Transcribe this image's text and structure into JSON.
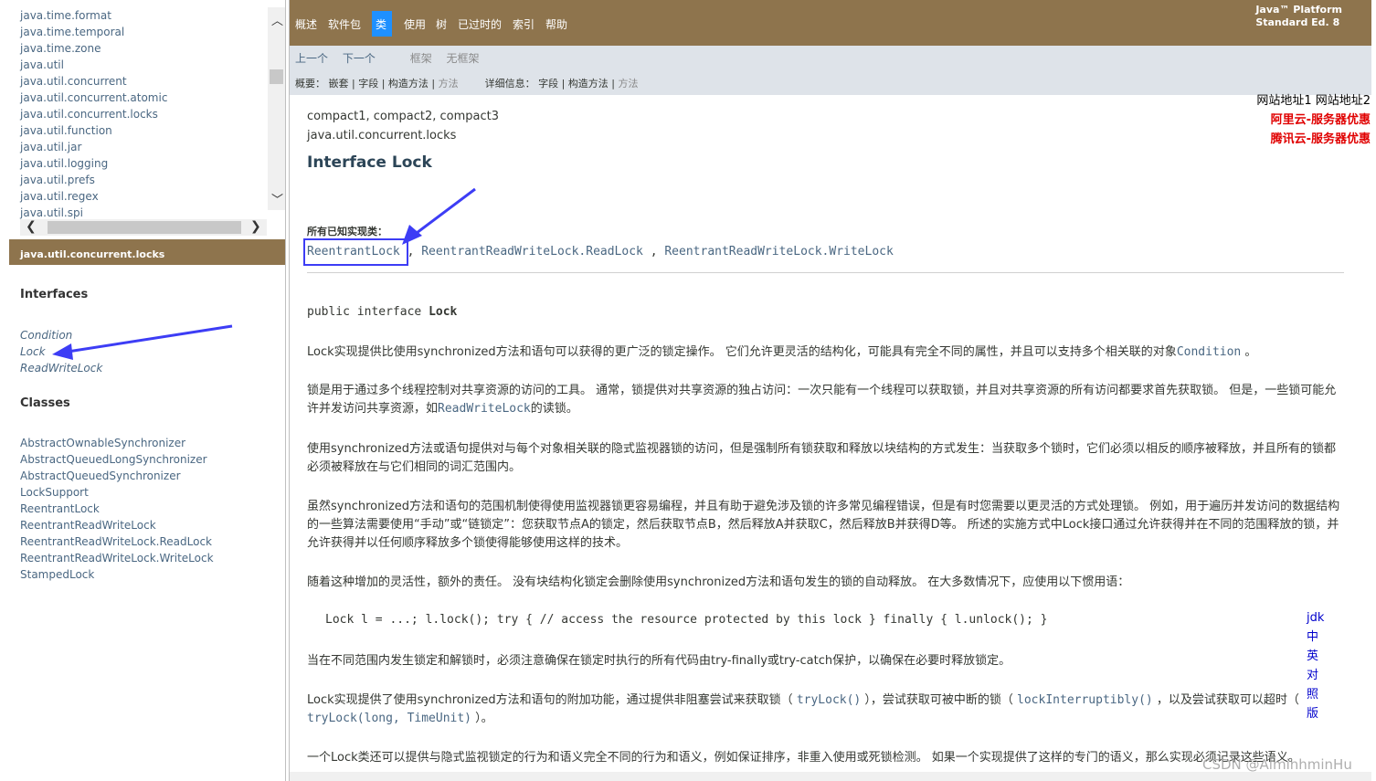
{
  "package_list": [
    "java.time.format",
    "java.time.temporal",
    "java.time.zone",
    "java.util",
    "java.util.concurrent",
    "java.util.concurrent.atomic",
    "java.util.concurrent.locks",
    "java.util.function",
    "java.util.jar",
    "java.util.logging",
    "java.util.prefs",
    "java.util.regex",
    "java.util.spi"
  ],
  "class_frame": {
    "header": "java.util.concurrent.locks",
    "interfaces_title": "Interfaces",
    "interfaces": [
      "Condition",
      "Lock",
      "ReadWriteLock"
    ],
    "classes_title": "Classes",
    "classes": [
      "AbstractOwnableSynchronizer",
      "AbstractQueuedLongSynchronizer",
      "AbstractQueuedSynchronizer",
      "LockSupport",
      "ReentrantLock",
      "ReentrantReadWriteLock",
      "ReentrantReadWriteLock.ReadLock",
      "ReentrantReadWriteLock.WriteLock",
      "StampedLock"
    ]
  },
  "topnav": {
    "items": [
      "概述",
      "软件包",
      "类",
      "使用",
      "树",
      "已过时的",
      "索引",
      "帮助"
    ],
    "platform_line1": "Java™ Platform",
    "platform_line2": "Standard Ed. 8"
  },
  "subnav": {
    "prev": "上一个",
    "next": "下一个",
    "frames": "框架",
    "noframes": "无框架",
    "summary_label": "概要：",
    "summary_nested": "嵌套",
    "summary_field": "字段",
    "summary_constr": "构造方法",
    "summary_method": "方法",
    "detail_label": "详细信息：",
    "detail_field": "字段",
    "detail_constr": "构造方法",
    "detail_method": "方法"
  },
  "right_ads": {
    "sites": "网站地址1 网站地址2",
    "ad1": "阿里云-服务器优惠",
    "ad2": "腾讯云-服务器优惠"
  },
  "side_links": [
    "jdk",
    "中",
    "英",
    "对",
    "照",
    "版"
  ],
  "content": {
    "profiles": "compact1, compact2, compact3",
    "package": "java.util.concurrent.locks",
    "title": "Interface Lock",
    "impl_label": "所有已知实现类：",
    "impl1": "ReentrantLock",
    "impl2": "ReentrantReadWriteLock.ReadLock",
    "impl3": "ReentrantReadWriteLock.WriteLock",
    "sig_prefix": "public interface ",
    "sig_name": "Lock",
    "p1a": "Lock实现提供比使用synchronized方法和语句可以获得的更广泛的锁定操作。 它们允许更灵活的结构化，可能具有完全不同的属性，并且可以支持多个相关联的对象",
    "p1_link": "Condition",
    "p1b": " 。",
    "p2a": "锁是用于通过多个线程控制对共享资源的访问的工具。 通常，锁提供对共享资源的独占访问：一次只能有一个线程可以获取锁，并且对共享资源的所有访问都要求首先获取锁。 但是，一些锁可能允许并发访问共享资源，如",
    "p2_link": "ReadWriteLock",
    "p2b": "的读锁。",
    "p3": "使用synchronized方法或语句提供对与每个对象相关联的隐式监视器锁的访问，但是强制所有锁获取和释放以块结构的方式发生：当获取多个锁时，它们必须以相反的顺序被释放，并且所有的锁都必须被释放在与它们相同的词汇范围内。",
    "p4": "虽然synchronized方法和语句的范围机制使得使用监视器锁更容易编程，并且有助于避免涉及锁的许多常见编程错误，但是有时您需要以更灵活的方式处理锁。 例如，用于遍历并发访问的数据结构的一些算法需要使用“手动”或“链锁定”：您获取节点A的锁定，然后获取节点B，然后释放A并获取C，然后释放B并获得D等。 所述的实施方式中Lock接口通过允许获得并在不同的范围释放的锁，并允许获得并以任何顺序释放多个锁使得能够使用这样的技术。",
    "p5": "随着这种增加的灵活性，额外的责任。 没有块结构化锁定会删除使用synchronized方法和语句发生的锁的自动释放。 在大多数情况下，应使用以下惯用语：",
    "code": "Lock l = ...; l.lock(); try { // access the resource protected by this lock } finally { l.unlock(); }",
    "p6": "当在不同范围内发生锁定和解锁时，必须注意确保在锁定时执行的所有代码由try-finally或try-catch保护，以确保在必要时释放锁定。",
    "p7a": "Lock实现提供了使用synchronized方法和语句的附加功能，通过提供非阻塞尝试来获取锁（ ",
    "p7_l1": "tryLock()",
    "p7b": " ），尝试获取可被中断的锁（ ",
    "p7_l2": "lockInterruptibly()",
    "p7c": " ，以及尝试获取可以超时（ ",
    "p7_l3": "tryLock(long, TimeUnit)",
    "p7d": " ）。",
    "p8": "一个Lock类还可以提供与隐式监视锁定的行为和语义完全不同的行为和语义，例如保证排序，非重入使用或死锁检测。 如果一个实现提供了这样的专门的语义，那么实现必须记录这些语义。"
  },
  "watermark": "CSDN @AlminhminHu",
  "colors": {
    "nav_bg": "#8e744d",
    "subnav_bg": "#dee3e9",
    "link": "#4a6782",
    "annotation": "#3d3df5"
  }
}
